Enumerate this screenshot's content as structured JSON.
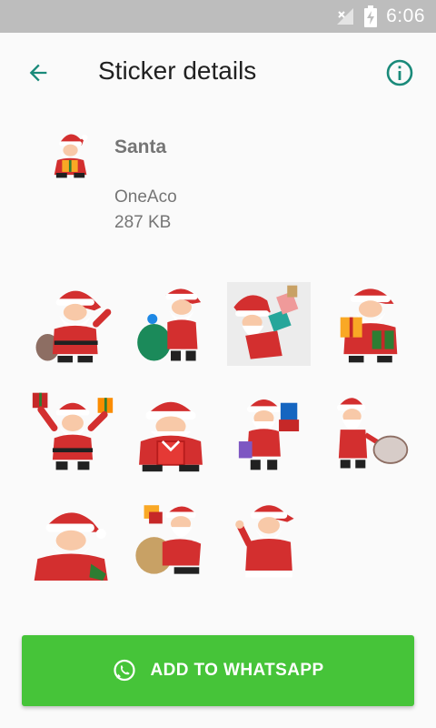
{
  "status_bar": {
    "time": "6:06",
    "icons": [
      "no-signal-icon",
      "battery-charging-icon"
    ]
  },
  "app_bar": {
    "title": "Sticker details",
    "back_icon": "arrow-back-icon",
    "info_icon": "info-icon",
    "accent_color": "#1a8a7a"
  },
  "pack": {
    "name": "Santa",
    "publisher": "OneAco",
    "size": "287 KB",
    "tray_icon": "santa-sticker"
  },
  "stickers": [
    {
      "name": "santa-with-sack-waving"
    },
    {
      "name": "santa-with-green-sack"
    },
    {
      "name": "santa-carrying-gifts"
    },
    {
      "name": "santa-holding-gifts"
    },
    {
      "name": "santa-raising-gifts"
    },
    {
      "name": "santa-holding-red-gift"
    },
    {
      "name": "santa-with-gift-bag"
    },
    {
      "name": "santa-pulling-sack"
    },
    {
      "name": "santa-smiling"
    },
    {
      "name": "santa-lying-with-gifts"
    },
    {
      "name": "santa-waving"
    }
  ],
  "add_button": {
    "label": "ADD TO WHATSAPP",
    "icon": "whatsapp-icon",
    "color": "#46c439"
  }
}
